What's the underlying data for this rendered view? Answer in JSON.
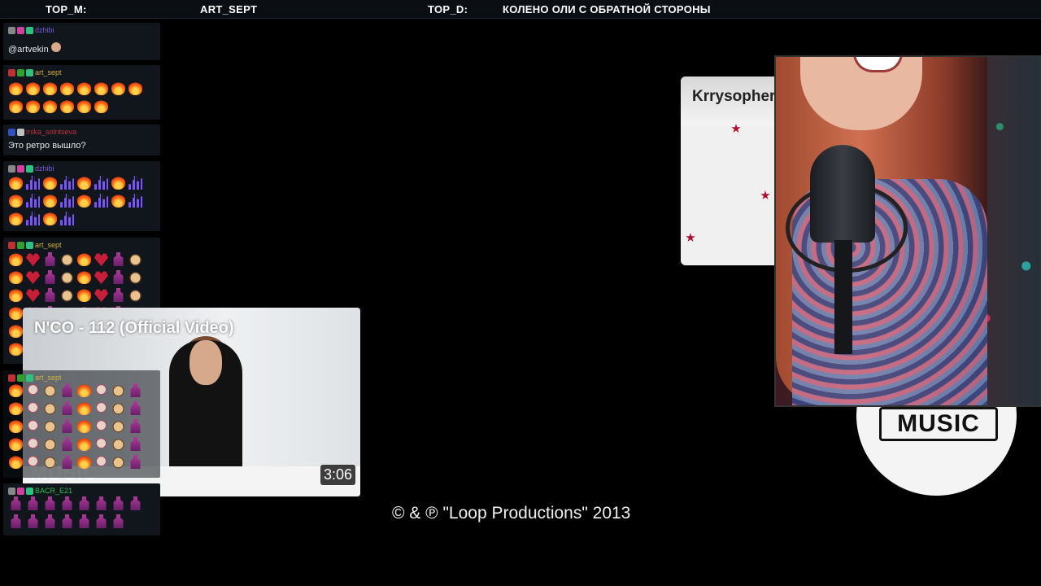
{
  "topbar": {
    "top_m_label": "TOP_M:",
    "top_m_value": "ART_SEPT",
    "top_d_label": "TOP_D:",
    "top_d_value": "КОЛЕНО ОЛИ С ОБРАТНОЙ СТОРОНЫ"
  },
  "chat": {
    "messages": [
      {
        "user": "dzhibi",
        "text": "@artvekin"
      },
      {
        "user": "art_sept",
        "text": ""
      },
      {
        "user": "mika_solntseva",
        "text": "Это ретро вышло?"
      },
      {
        "user": "dzhibi",
        "text": ""
      },
      {
        "user": "art_sept",
        "text": ""
      },
      {
        "user": "art_sept",
        "text": ""
      },
      {
        "user": "BACR_E21",
        "text": ""
      }
    ]
  },
  "video": {
    "title": "N'CO - 112 (Official Video)",
    "duration": "3:06",
    "watermark": "MUSIC"
  },
  "card": {
    "title": "Krrysopher"
  },
  "logo": {
    "text": "MUSIC"
  },
  "footer": {
    "copyright": "© & ℗  \"Loop Productions\"   2013"
  },
  "colors": {
    "background": "#000000",
    "fire": "#ff7a1a",
    "accent_star": "#b01030"
  }
}
